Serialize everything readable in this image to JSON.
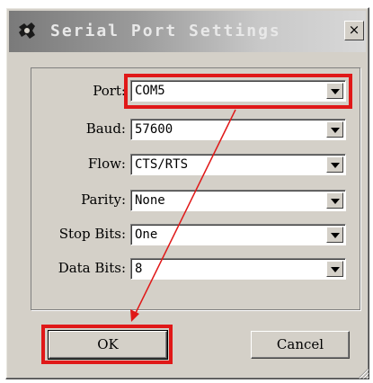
{
  "window": {
    "title": "Serial Port Settings",
    "close_label": "×"
  },
  "fields": [
    {
      "label": "Port:",
      "value": "COM5"
    },
    {
      "label": "Baud:",
      "value": "57600"
    },
    {
      "label": "Flow:",
      "value": "CTS/RTS"
    },
    {
      "label": "Parity:",
      "value": "None"
    },
    {
      "label": "Stop Bits:",
      "value": "One"
    },
    {
      "label": "Data Bits:",
      "value": "8"
    }
  ],
  "buttons": {
    "ok": "OK",
    "cancel": "Cancel"
  },
  "colors": {
    "highlight": "#e01818",
    "dialog_face": "#d4d0c8"
  },
  "icons": {
    "app": "app-icon",
    "close": "close-icon",
    "dropdown": "chevron-down-icon",
    "resize": "resize-grip-icon"
  }
}
